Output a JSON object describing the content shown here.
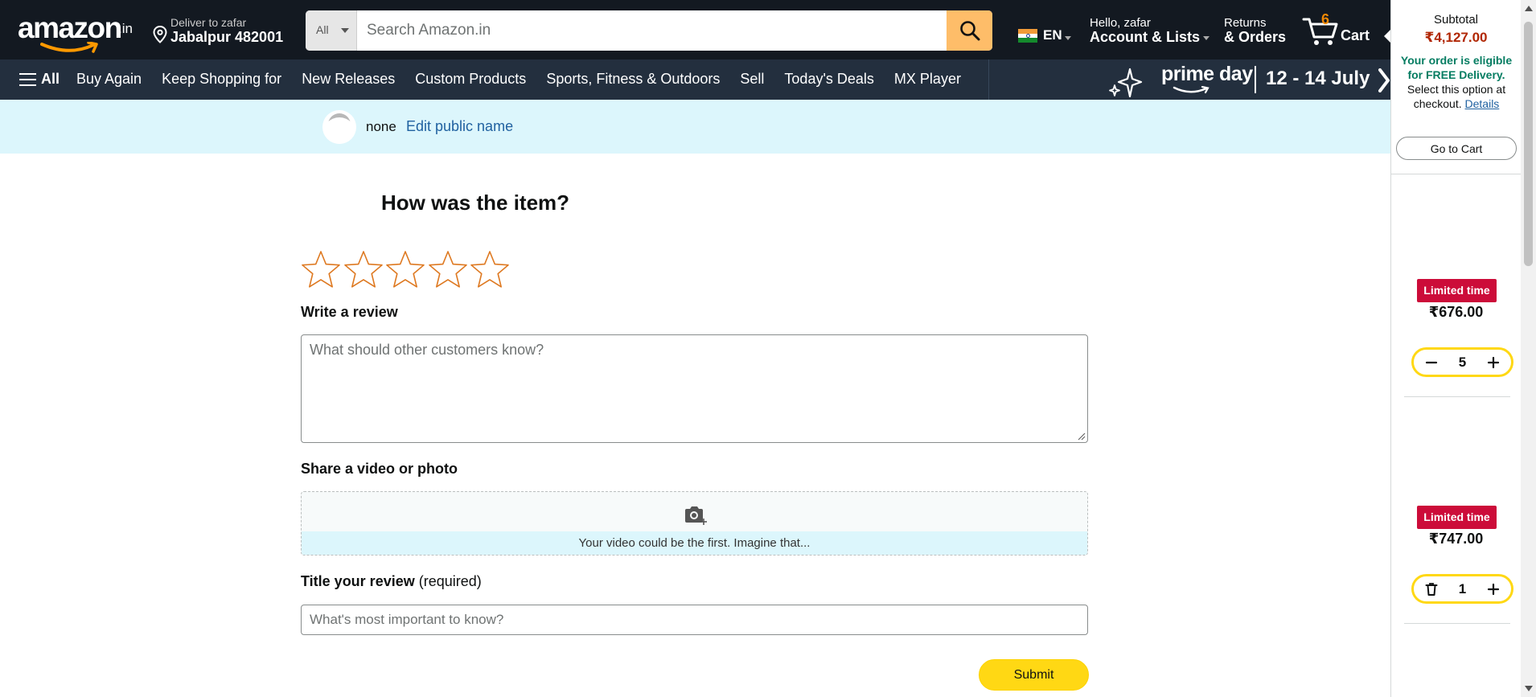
{
  "header": {
    "logo_text": "amazon",
    "logo_tld": ".in",
    "deliver_line1": "Deliver to zafar",
    "deliver_line2": "Jabalpur 482001",
    "search_category": "All",
    "search_placeholder": "Search Amazon.in",
    "language": "EN",
    "account_line1": "Hello, zafar",
    "account_line2": "Account & Lists",
    "returns_line1": "Returns",
    "returns_line2": "& Orders",
    "cart_count": "6",
    "cart_label": "Cart"
  },
  "subnav": {
    "all_label": "All",
    "links": [
      "Buy Again",
      "Keep Shopping for",
      "New Releases",
      "Custom Products",
      "Sports, Fitness & Outdoors",
      "Sell",
      "Today's Deals",
      "MX Player"
    ],
    "banner_brand": "prime day",
    "banner_dates": "12 - 14 July"
  },
  "profile": {
    "public_name": "none",
    "edit_link": "Edit public name"
  },
  "review": {
    "question": "How was the item?",
    "rating": 0,
    "rating_max": 5,
    "write_label": "Write a review",
    "write_placeholder": "What should other customers know?",
    "share_label": "Share a video or photo",
    "share_hint": "Your video could be the first. Imagine that...",
    "title_label": "Title your review",
    "title_required": "(required)",
    "title_placeholder": "What's most important to know?",
    "submit_label": "Submit"
  },
  "cart_panel": {
    "subtotal_label": "Subtotal",
    "subtotal_value": "₹4,127.00",
    "free_bold": "Your order is eligible for FREE Delivery.",
    "free_rest": "Select this option at checkout.",
    "details_link": "Details",
    "go_to_cart": "Go to Cart",
    "items": [
      {
        "badge": "Limited time",
        "price": "₹676.00",
        "qty": "5",
        "left_action": "minus"
      },
      {
        "badge": "Limited time",
        "price": "₹747.00",
        "qty": "1",
        "left_action": "delete"
      }
    ]
  },
  "colors": {
    "nav_dark": "#131921",
    "nav_sub": "#232f3e",
    "search_button": "#febd69",
    "star_outline": "#de7921",
    "link_blue": "#2162a1",
    "price_red": "#b12704",
    "badge_red": "#cc0c39",
    "submit_yellow": "#ffd814",
    "free_green": "#067d62"
  }
}
